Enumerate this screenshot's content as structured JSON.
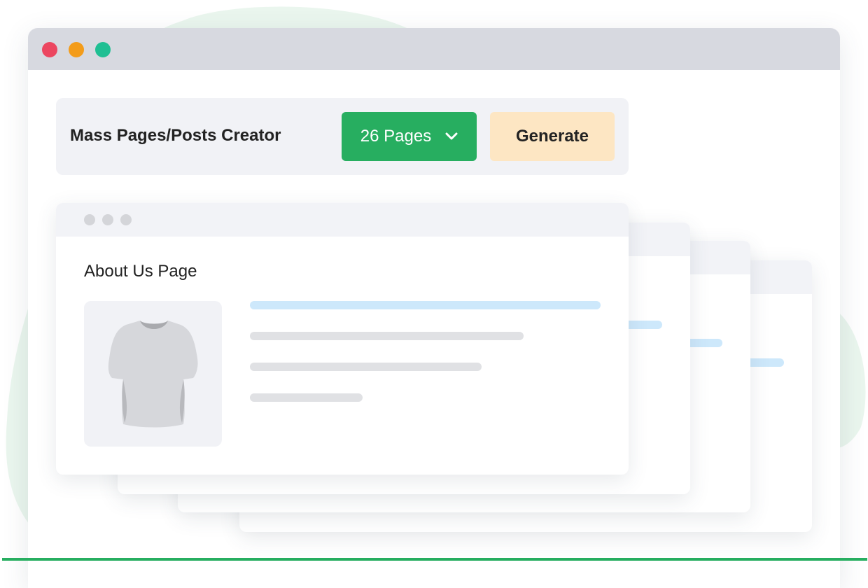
{
  "colors": {
    "accent_green": "#27ae60",
    "generate_bg": "#fde6c3",
    "dot_red": "#ec4660",
    "dot_orange": "#f39c1a",
    "dot_teal": "#1fbf93",
    "blob_green": "#eaf6ee",
    "skeleton_blue": "#cde8fb",
    "skeleton_gray": "#e0e1e4"
  },
  "window": {
    "controls": [
      "close-dot",
      "minimize-dot",
      "maximize-dot"
    ]
  },
  "toolbar": {
    "title": "Mass Pages/Posts Creator",
    "pages_select": {
      "value": "26 Pages",
      "icon": "chevron-down-icon"
    },
    "generate_label": "Generate"
  },
  "preview": {
    "page_title": "About Us Page",
    "thumbnail_icon": "t-shirt-icon"
  }
}
